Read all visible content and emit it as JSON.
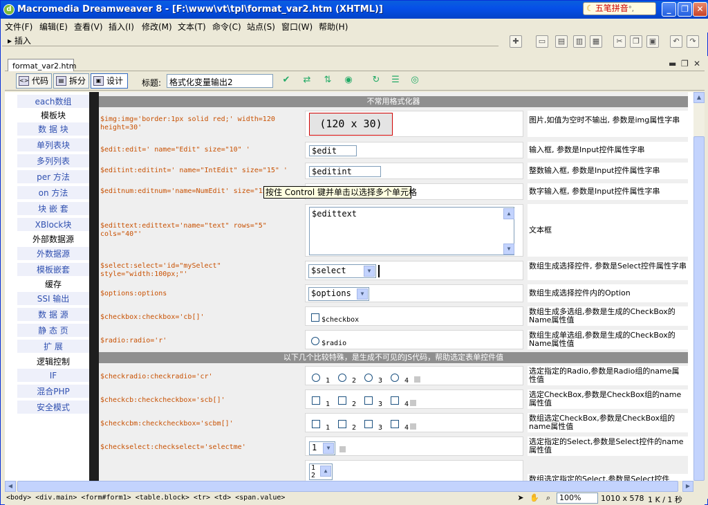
{
  "window": {
    "title": "Macromedia Dreamweaver 8 - [F:\\www\\vt\\tpl\\format_var2.htm (XHTML)]",
    "ime": "五笔拼音",
    "ime_extra": "°,"
  },
  "menu": [
    "文件(F)",
    "编辑(E)",
    "查看(V)",
    "插入(I)",
    "修改(M)",
    "文本(T)",
    "命令(C)",
    "站点(S)",
    "窗口(W)",
    "帮助(H)"
  ],
  "insert_bar": {
    "label": "插入"
  },
  "document": {
    "tab": "format_var2.htm",
    "view_buttons": [
      "代码",
      "拆分",
      "设计"
    ],
    "title_label": "标题:",
    "title_value": "格式化变量输出2"
  },
  "sidebar": [
    {
      "label": "each数组",
      "head": false
    },
    {
      "label": "模板块",
      "head": true
    },
    {
      "label": "数 据 块",
      "head": false
    },
    {
      "label": "单列表块",
      "head": false
    },
    {
      "label": "多列列表",
      "head": false
    },
    {
      "label": "per 方法",
      "head": false
    },
    {
      "label": "on  方法",
      "head": false
    },
    {
      "label": "块 嵌 套",
      "head": false
    },
    {
      "label": "XBlock块",
      "head": false
    },
    {
      "label": "外部数据源",
      "head": true
    },
    {
      "label": "外数据源",
      "head": false
    },
    {
      "label": "模板嵌套",
      "head": false
    },
    {
      "label": "缓存",
      "head": true
    },
    {
      "label": "SSI 输出",
      "head": false
    },
    {
      "label": "数 据 源",
      "head": false
    },
    {
      "label": "静 态 页",
      "head": false
    },
    {
      "label": "扩   展",
      "head": false
    },
    {
      "label": "逻辑控制",
      "head": true
    },
    {
      "label": "IF",
      "head": false
    },
    {
      "label": "混合PHP",
      "head": false
    },
    {
      "label": "安全模式",
      "head": false
    }
  ],
  "band1": "不常用格式化器",
  "band2": "以下几个比较特殊，是生成不可见的JS代码，帮助选定表单控件值",
  "rows": {
    "img": {
      "code": "$img:img='border:1px solid red;' width=120 height=30'",
      "value": "(120 x 30)",
      "desc": "图片,如值为空时不输出, 参数是img属性字串"
    },
    "edit": {
      "code": "$edit:edit=' name=\"Edit\" size=\"10\" '",
      "value": "$edit",
      "desc": "输入框, 参数是Input控件属性字串"
    },
    "editint": {
      "code": "$editint:editint=' name=\"IntEdit\" size=\"15\" '",
      "value": "$editint",
      "desc": "整数输入框, 参数是Input控件属性字串"
    },
    "editnum": {
      "code": "$editnum:editnum='name=NumEdit' size=\"15\"",
      "desc": "数字输入框, 参数是Input控件属性字串"
    },
    "edittext": {
      "code": "$edittext:edittext='name=\"text\" rows=\"5\" cols=\"40\"'",
      "value": "$edittext",
      "desc": "文本框"
    },
    "select": {
      "code": "$select:select='id=\"mySelect\" style=\"width:100px;\"'",
      "value": "$select",
      "desc": "数组生成选择控件, 参数是Select控件属性字串"
    },
    "options": {
      "code": "$options:options",
      "value": "$options",
      "desc": "数组生成选择控件内的Option"
    },
    "checkbox": {
      "code": "$checkbox:checkbox='cb[]'",
      "value": "$checkbox",
      "desc": "数组生成多选组,参数是生成的CheckBox的Name属性值"
    },
    "radio": {
      "code": "$radio:radio='r'",
      "value": "$radio",
      "desc": "数组生成单选组,参数是生成的CheckBox的Name属性值"
    },
    "checkradio": {
      "code": "$checkradio:checkradio='cr'",
      "nums": [
        "1",
        "2",
        "3",
        "4"
      ],
      "desc": "选定指定的Radio,参数是Radio组的name属性值"
    },
    "checkcb": {
      "code": "$checkcb:checkcheckbox='scb[]'",
      "nums": [
        "1",
        "2",
        "3",
        "4"
      ],
      "desc": "选定CheckBox,参数是CheckBox组的name属性值"
    },
    "checkcbm": {
      "code": "$checkcbm:checkcheckbox='scbm[]'",
      "nums": [
        "1",
        "2",
        "3",
        "4"
      ],
      "desc": "数组选定CheckBox,参数是CheckBox组的name属性值"
    },
    "checkselect": {
      "code": "$checkselect:checkselect='selectme'",
      "value": "1",
      "desc": "选定指定的Select,参数是Select控件的name属性值"
    },
    "multiselect": {
      "items": [
        "1",
        "2"
      ],
      "desc": "数组选定指定的Select,参数是Select控件"
    }
  },
  "tooltip": "按住 Control 键并单击以选择多个单元格",
  "statusbar": {
    "tags": "<body> <div.main> <form#form1> <table.block> <tr> <td> <span.value>",
    "zoom": "100%",
    "dimensions": "1010 x 578",
    "size": "1 K / 1 秒"
  }
}
